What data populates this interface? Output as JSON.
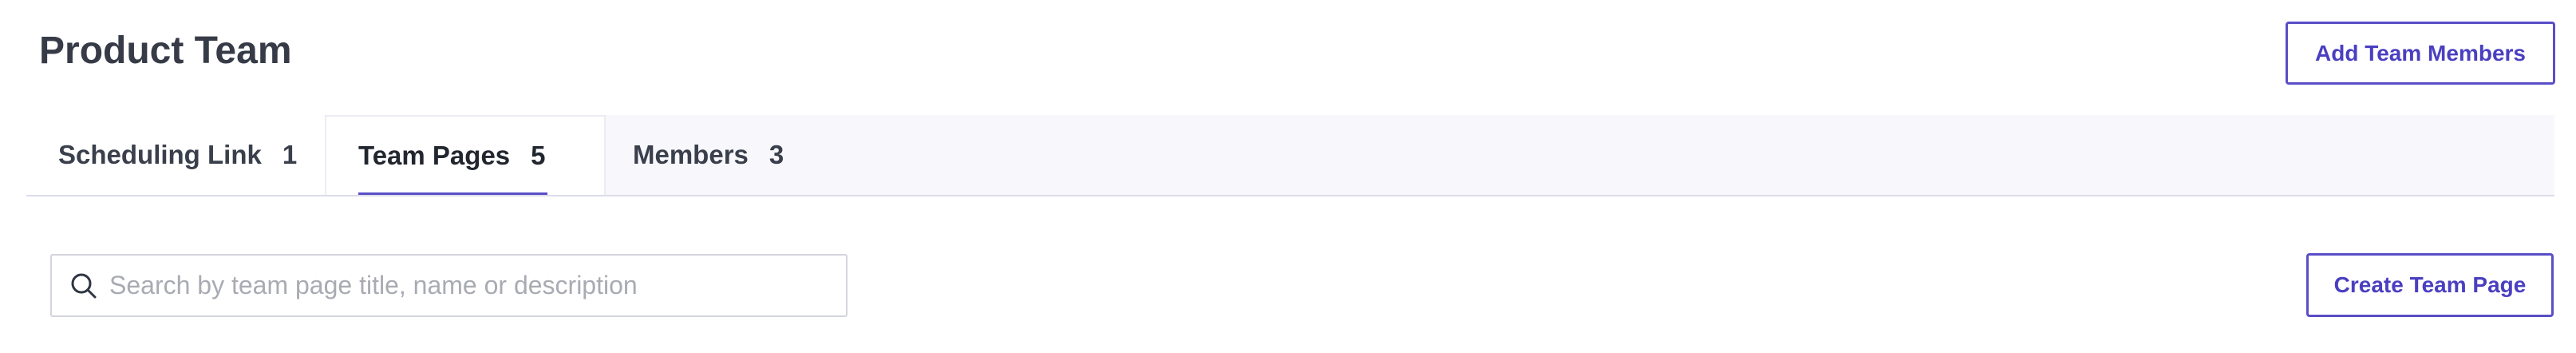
{
  "header": {
    "title": "Product Team",
    "add_members_label": "Add Team Members"
  },
  "tabs": [
    {
      "label": "Scheduling Link",
      "count": "1",
      "active": false
    },
    {
      "label": "Team Pages",
      "count": "5",
      "active": true
    },
    {
      "label": "Members",
      "count": "3",
      "active": false
    }
  ],
  "search": {
    "placeholder": "Search by team page title, name or description",
    "value": "",
    "icon": "search-icon"
  },
  "actions": {
    "create_page_label": "Create Team Page"
  },
  "colors": {
    "accent": "#5a4ec7",
    "text": "#363b47",
    "tab_bar_bg": "#f7f7fc",
    "border": "#dcdde8"
  }
}
